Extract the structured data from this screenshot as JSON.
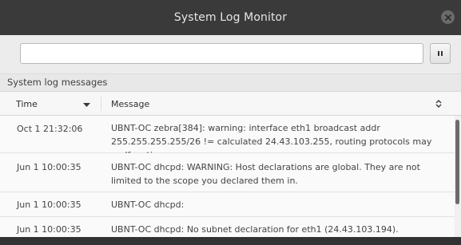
{
  "window": {
    "title": "System Log Monitor"
  },
  "toolbar": {
    "search_value": "",
    "search_placeholder": "",
    "pause_icon": "pause-icon"
  },
  "section": {
    "label": "System log messages"
  },
  "table": {
    "columns": [
      "Time",
      "Message"
    ],
    "rows": [
      {
        "time": "Oct 1 21:32:06",
        "message": "UBNT-OC zebra[384]: warning: interface eth1 broadcast addr 255.255.255.255/26 != calculated 24.43.103.255, routing protocols may malfunction"
      },
      {
        "time": "Jun 1 10:00:35",
        "message": "UBNT-OC dhcpd: WARNING: Host declarations are global. They are not limited to the scope you declared them in."
      },
      {
        "time": "Jun 1 10:00:35",
        "message": "UBNT-OC dhcpd:"
      },
      {
        "time": "Jun 1 10:00:35",
        "message": "UBNT-OC dhcpd: No subnet declaration for eth1 (24.43.103.194)."
      }
    ]
  },
  "colors": {
    "titlebar": "#3a3a3a",
    "background": "#f2f1f0",
    "scroll_thumb": "#6b6b6b"
  }
}
